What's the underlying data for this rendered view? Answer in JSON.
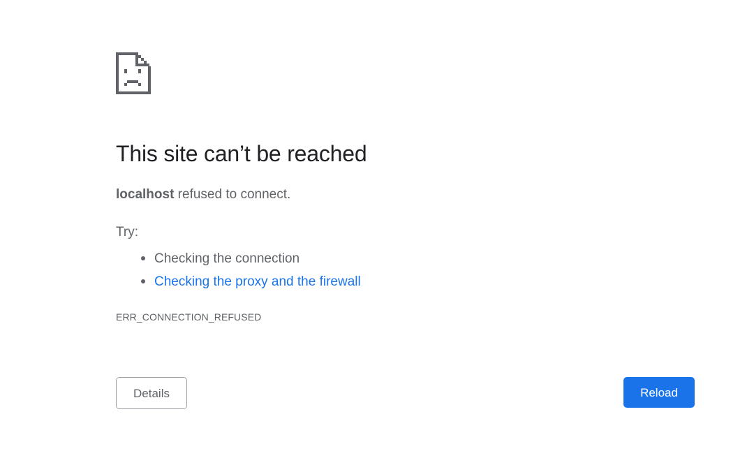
{
  "error": {
    "icon": "sad-page-icon",
    "title": "This site can’t be reached",
    "host": "localhost",
    "summary_rest": " refused to connect.",
    "try_label": "Try:",
    "suggestions": [
      {
        "text": "Checking the connection",
        "is_link": false
      },
      {
        "text": "Checking the proxy and the firewall",
        "is_link": true
      }
    ],
    "code": "ERR_CONNECTION_REFUSED"
  },
  "buttons": {
    "details_label": "Details",
    "reload_label": "Reload"
  },
  "colors": {
    "background": "#ffffff",
    "title": "#202124",
    "text": "#5f6368",
    "link": "#1a73e8",
    "primary_button": "#1a73e8",
    "secondary_border": "#9aa0a6"
  }
}
